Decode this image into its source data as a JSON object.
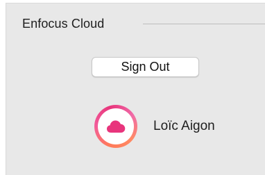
{
  "section": {
    "title": "Enfocus Cloud"
  },
  "account": {
    "sign_out_label": "Sign Out",
    "user_name": "Loïc Aigon"
  },
  "avatar": {
    "icon": "cloud-icon",
    "accent_color": "#e8357c",
    "ring_colors": [
      "#ff7a59",
      "#f25c9a",
      "#e8357c"
    ]
  }
}
